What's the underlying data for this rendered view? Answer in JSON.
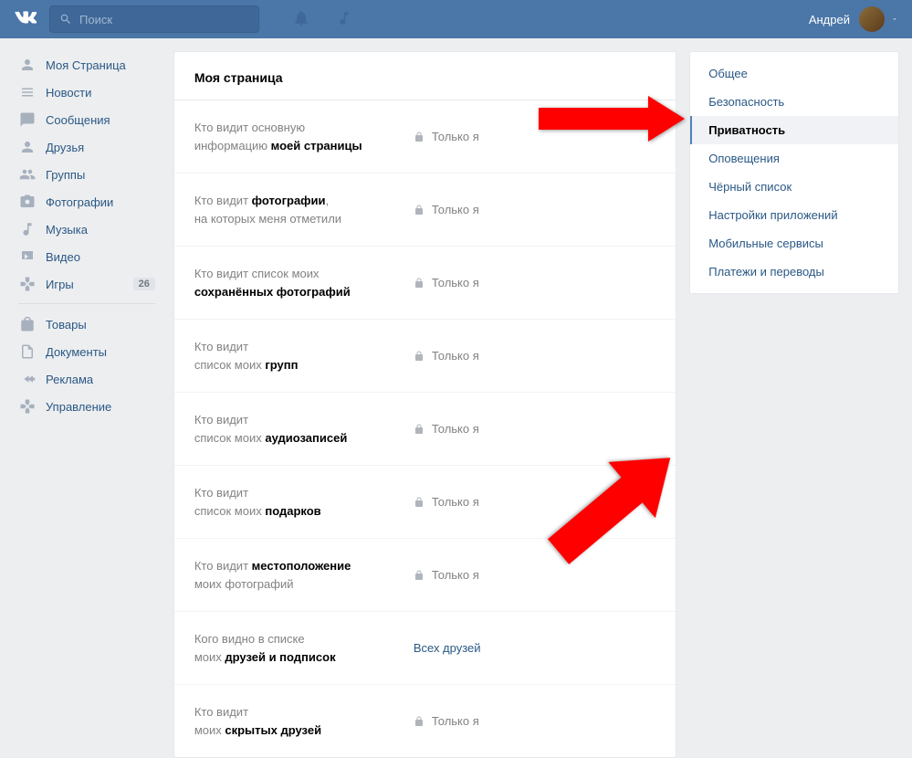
{
  "header": {
    "search_placeholder": "Поиск",
    "username": "Андрей"
  },
  "sidebar": {
    "items": [
      {
        "label": "Моя Страница"
      },
      {
        "label": "Новости"
      },
      {
        "label": "Сообщения"
      },
      {
        "label": "Друзья"
      },
      {
        "label": "Группы"
      },
      {
        "label": "Фотографии"
      },
      {
        "label": "Музыка"
      },
      {
        "label": "Видео"
      },
      {
        "label": "Игры",
        "badge": "26"
      }
    ],
    "items2": [
      {
        "label": "Товары"
      },
      {
        "label": "Документы"
      },
      {
        "label": "Реклама"
      },
      {
        "label": "Управление"
      }
    ]
  },
  "main": {
    "title": "Моя страница",
    "only_me": "Только я",
    "all_friends": "Всех друзей",
    "rows": [
      {
        "pre": "Кто видит основную",
        "post": "информацию ",
        "bold": "моей страницы",
        "val": "only_me"
      },
      {
        "pre": "Кто видит ",
        "bold": "фотографии",
        "afterbold": ",",
        "post2": "на которых меня отметили",
        "val": "only_me"
      },
      {
        "pre": "Кто видит список моих",
        "bold2": "сохранённых фотографий",
        "val": "only_me"
      },
      {
        "pre": "Кто видит",
        "post": "список моих ",
        "bold": "групп",
        "val": "only_me"
      },
      {
        "pre": "Кто видит",
        "post": "список моих ",
        "bold": "аудиозаписей",
        "val": "only_me"
      },
      {
        "pre": "Кто видит",
        "post": "список моих ",
        "bold": "подарков",
        "val": "only_me"
      },
      {
        "pre": "Кто видит ",
        "bold": "местоположение",
        "post2": "моих фотографий",
        "val": "only_me"
      },
      {
        "pre": "Кого видно в списке",
        "post": "моих ",
        "bold": "друзей и подписок",
        "val": "all_friends"
      },
      {
        "pre": "Кто видит",
        "post": "моих ",
        "bold": "скрытых друзей",
        "val": "only_me"
      }
    ]
  },
  "right": {
    "items": [
      {
        "label": "Общее"
      },
      {
        "label": "Безопасность"
      },
      {
        "label": "Приватность",
        "active": true
      },
      {
        "label": "Оповещения"
      },
      {
        "label": "Чёрный список"
      },
      {
        "label": "Настройки приложений"
      },
      {
        "label": "Мобильные сервисы"
      },
      {
        "label": "Платежи и переводы"
      }
    ]
  }
}
